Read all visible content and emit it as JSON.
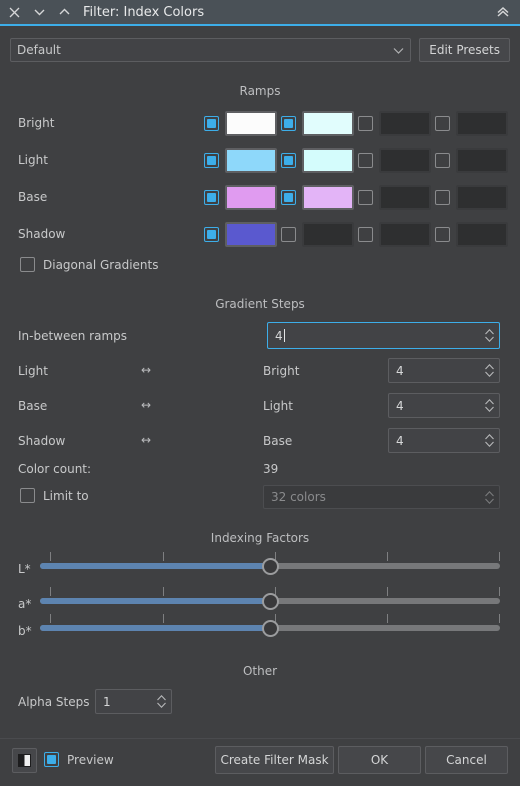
{
  "window": {
    "title": "Filter: Index Colors",
    "icons": {
      "close": "close-icon",
      "collapse_down": "chevron-down-icon",
      "collapse_up": "chevron-up-icon",
      "shade": "double-chevron-up-icon"
    }
  },
  "preset": {
    "value": "Default",
    "edit_label": "Edit Presets"
  },
  "ramps": {
    "heading": "Ramps",
    "rows": [
      {
        "label": "Bright",
        "slots": [
          {
            "checked": true,
            "color": "#fcfcfc",
            "active": true
          },
          {
            "checked": true,
            "color": "#e1fdfd",
            "active": true
          },
          {
            "checked": false,
            "color": "#2e2f30",
            "active": false
          },
          {
            "checked": false,
            "color": "#2e2f30",
            "active": false
          }
        ]
      },
      {
        "label": "Light",
        "slots": [
          {
            "checked": true,
            "color": "#8ed8fa",
            "active": true
          },
          {
            "checked": true,
            "color": "#d4fcfc",
            "active": true
          },
          {
            "checked": false,
            "color": "#2e2f30",
            "active": false
          },
          {
            "checked": false,
            "color": "#2e2f30",
            "active": false
          }
        ]
      },
      {
        "label": "Base",
        "slots": [
          {
            "checked": true,
            "color": "#e09bf0",
            "active": true
          },
          {
            "checked": true,
            "color": "#e3b4f7",
            "active": true
          },
          {
            "checked": false,
            "color": "#2e2f30",
            "active": false
          },
          {
            "checked": false,
            "color": "#2e2f30",
            "active": false
          }
        ]
      },
      {
        "label": "Shadow",
        "slots": [
          {
            "checked": true,
            "color": "#5a59cf",
            "active": true
          },
          {
            "checked": false,
            "color": "#2e2f30",
            "active": false
          },
          {
            "checked": false,
            "color": "#2e2f30",
            "active": false
          },
          {
            "checked": false,
            "color": "#2e2f30",
            "active": false
          }
        ]
      }
    ],
    "diagonal_gradients": {
      "label": "Diagonal Gradients",
      "checked": false
    }
  },
  "gradient_steps": {
    "heading": "Gradient Steps",
    "in_between": {
      "label": "In-between ramps",
      "value": "4",
      "focused": true
    },
    "pairs": [
      {
        "left": "Light",
        "arrow": "↔",
        "right": "Bright",
        "value": "4"
      },
      {
        "left": "Base",
        "arrow": "↔",
        "right": "Light",
        "value": "4"
      },
      {
        "left": "Shadow",
        "arrow": "↔",
        "right": "Base",
        "value": "4"
      }
    ],
    "color_count": {
      "label": "Color count:",
      "value": "39"
    },
    "limit_to": {
      "label": "Limit to",
      "checked": false,
      "value": "32 colors",
      "enabled": false
    }
  },
  "indexing_factors": {
    "heading": "Indexing Factors",
    "sliders": [
      {
        "label": "L*",
        "percent": 50
      },
      {
        "label": "a*",
        "percent": 50
      },
      {
        "label": "b*",
        "percent": 50
      }
    ],
    "tick_percents": [
      0,
      25,
      50,
      75,
      100
    ]
  },
  "other": {
    "heading": "Other",
    "alpha_steps": {
      "label": "Alpha Steps",
      "value": "1"
    }
  },
  "footer": {
    "split_view_icon": "split-view-icon",
    "preview": {
      "label": "Preview",
      "checked": true
    },
    "buttons": [
      {
        "name": "create-filter-mask-button",
        "label": "Create Filter Mask"
      },
      {
        "name": "ok-button",
        "label": "OK"
      },
      {
        "name": "cancel-button",
        "label": "Cancel"
      }
    ]
  },
  "colors": {
    "accent": "#3daee9",
    "window_bg": "#3f4042",
    "titlebar_bg": "#4a5157",
    "slider_fill": "#5d84b0"
  }
}
